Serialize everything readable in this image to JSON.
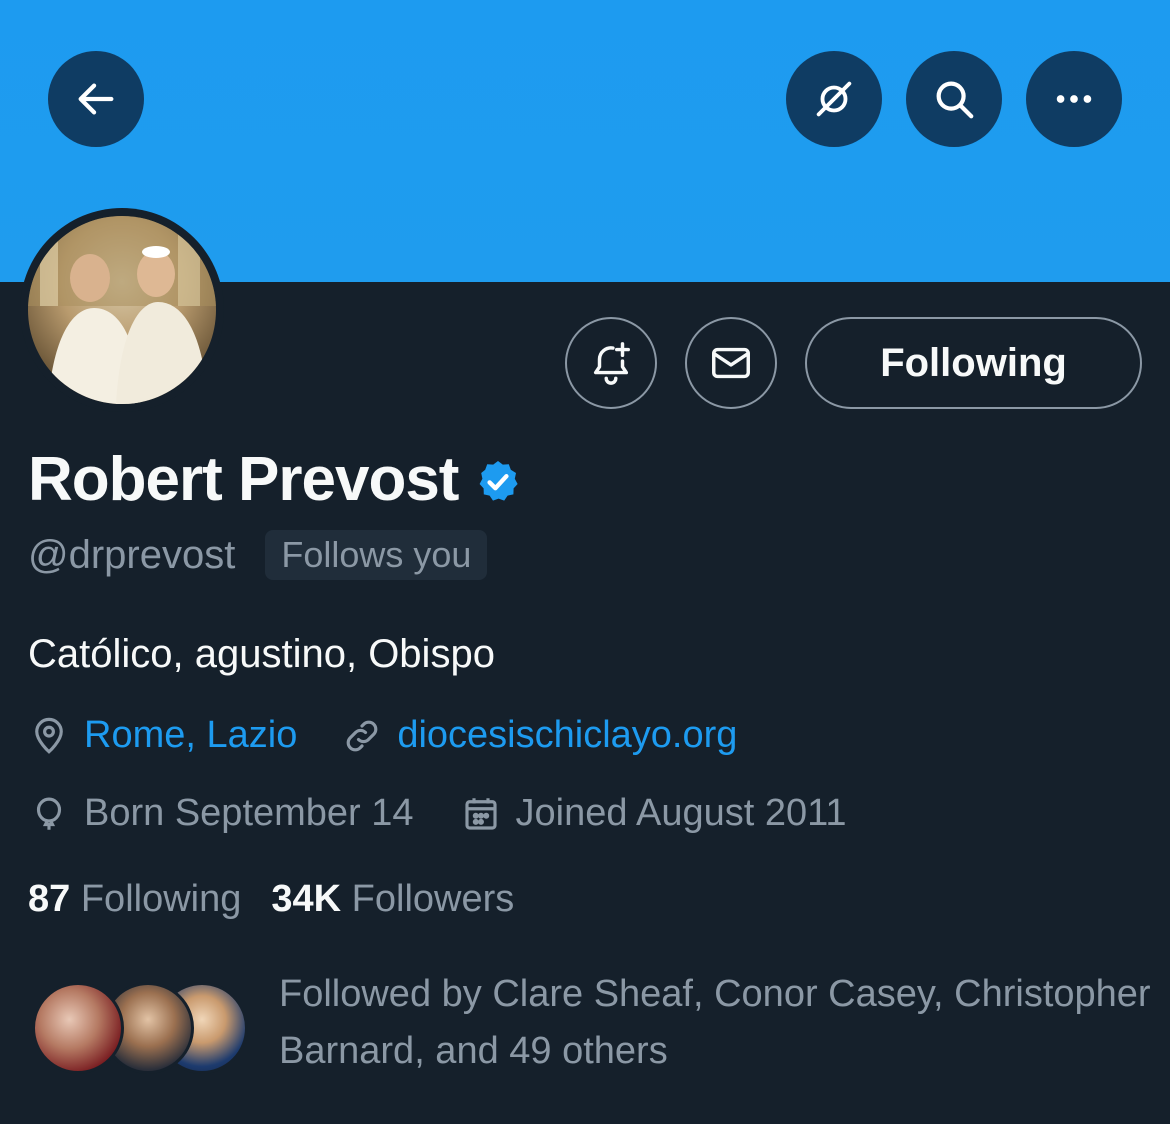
{
  "header": {
    "back_icon": "arrow-left-icon",
    "noview_icon": "eye-slash-icon",
    "search_icon": "search-icon",
    "more_icon": "more-horizontal-icon",
    "banner_color": "#1d9bf0"
  },
  "actions": {
    "notify_icon": "bell-plus-icon",
    "message_icon": "envelope-icon",
    "following_label": "Following"
  },
  "profile": {
    "name": "Robert Prevost",
    "handle": "@drprevost",
    "follows_you": "Follows you",
    "bio": "Católico, agustino, Obispo",
    "location": "Rome, Lazio",
    "website": "diocesischiclayo.org",
    "birthday": "Born September 14",
    "joined": "Joined August 2011"
  },
  "stats": {
    "following_count": "87",
    "following_label": "Following",
    "followers_count": "34K",
    "followers_label": "Followers"
  },
  "followed_by": "Followed by Clare Sheaf, Conor Casey, Christopher Barnard, and 49 others",
  "colors": {
    "background": "#15202b",
    "accent": "#1d9bf0",
    "muted": "#8b98a5"
  }
}
